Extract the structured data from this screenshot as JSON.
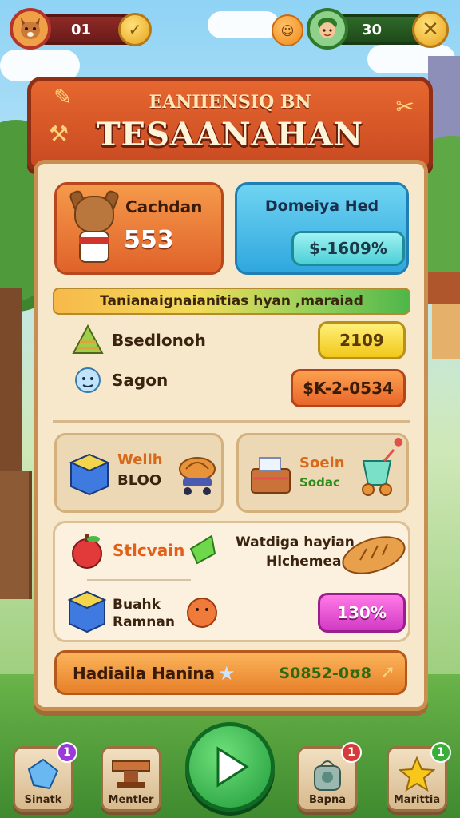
{
  "hud": {
    "left_value": "01",
    "right_value": "30"
  },
  "header": {
    "subtitle": "EANIIENSIQ BN",
    "title": "TESAANAHAN"
  },
  "cards": {
    "character_name": "Cachdan",
    "character_value": "553",
    "blue_title": "Domeiya Hed",
    "blue_value": "$-1609%"
  },
  "banner": "Tanianaignaianitias hyan ,maraiad",
  "rows": [
    {
      "label": "Bsedlonoh",
      "value": "2109"
    },
    {
      "label": "Sagon",
      "value": "$K-2-0534"
    }
  ],
  "tiles": {
    "left_line1": "Wellh",
    "left_line2": "BLOO",
    "right_line1": "Soeln",
    "right_line2": "Sodac"
  },
  "big_card": {
    "label1": "Stlcvain",
    "text_line1": "Watdiga hayian",
    "text_line2": "Hlchemean",
    "label2_line1": "Buahk",
    "label2_line2": "Ramnan",
    "value": "130%"
  },
  "footer": {
    "left": "Hadiaila Hanina",
    "right": "S0852-0ʊ8"
  },
  "nav": [
    {
      "label": "Sinatk",
      "badge": "1"
    },
    {
      "label": "Mentler",
      "badge": ""
    },
    {
      "label": "Bapna",
      "badge": "1"
    },
    {
      "label": "Marittia",
      "badge": "1"
    }
  ],
  "colors": {
    "header": "#d9572a",
    "panel": "#f7e8cc",
    "play": "#2aae44",
    "pink": "#e04cd0"
  }
}
